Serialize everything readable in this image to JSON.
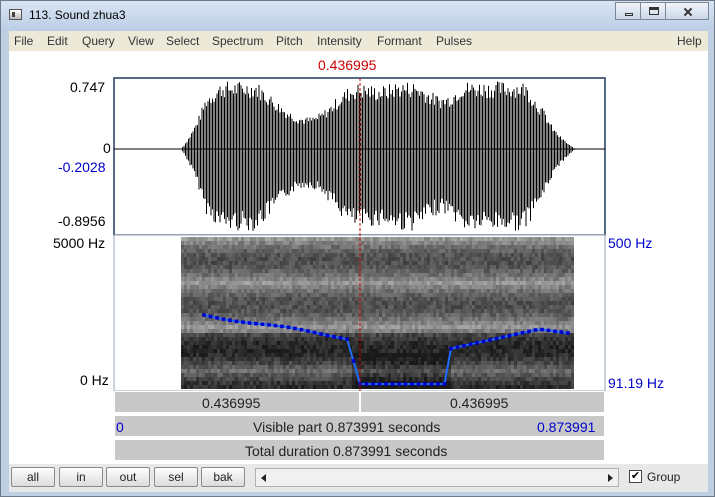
{
  "window": {
    "title": "113. Sound zhua3"
  },
  "menu": [
    "File",
    "Edit",
    "Query",
    "View",
    "Select",
    "Spectrum",
    "Pitch",
    "Intensity",
    "Formant",
    "Pulses",
    "Help"
  ],
  "cursor_time": "0.436995",
  "waveform": {
    "max": "0.747",
    "zero": "0",
    "cursor_value": "-0.2028",
    "min": "-0.8956"
  },
  "spectrogram": {
    "freq_top": "5000 Hz",
    "freq_bottom": "0 Hz",
    "pitch_top": "500 Hz",
    "pitch_bottom": "91.19 Hz"
  },
  "time_bar": {
    "left_value": "0.436995",
    "right_value": "0.436995"
  },
  "visible_bar": {
    "start": "0",
    "label": "Visible part 0.873991 seconds",
    "end": "0.873991"
  },
  "total_bar": {
    "label": "Total duration 0.873991 seconds"
  },
  "buttons": {
    "all": "all",
    "in": "in",
    "out": "out",
    "sel": "sel",
    "bak": "bak"
  },
  "group": {
    "label": "Group",
    "checked": true
  },
  "colors": {
    "cursor": "#cc0000",
    "pitch": "#0000cc",
    "pitch_curve": "#1e6cff"
  }
}
